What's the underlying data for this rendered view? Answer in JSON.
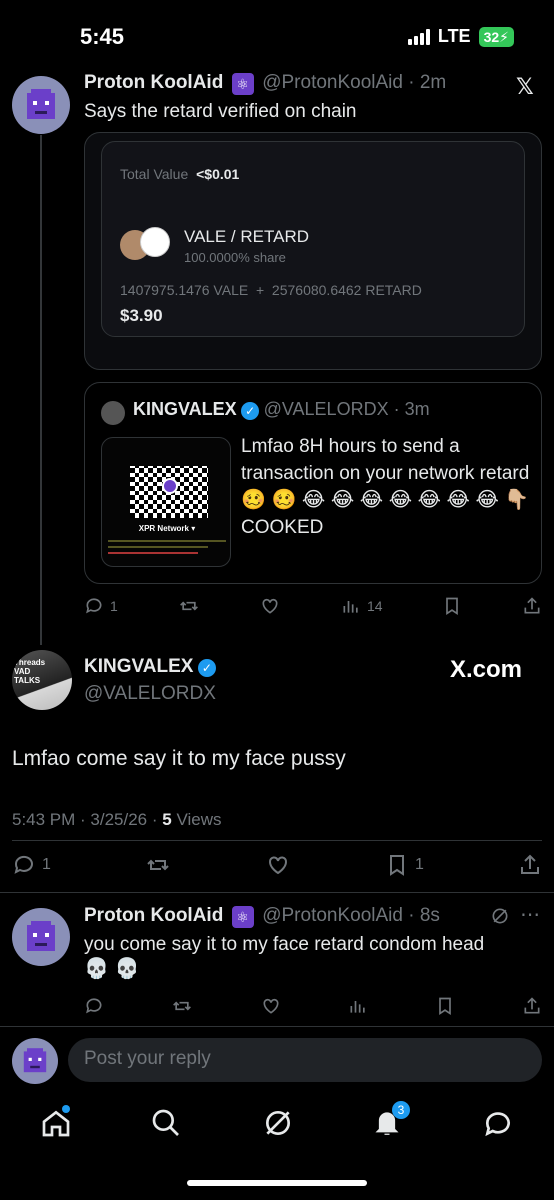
{
  "status": {
    "time": "5:45",
    "network": "LTE",
    "battery": "32"
  },
  "post1": {
    "name": "Proton KoolAid",
    "handle": "@ProtonKoolAid · 2m",
    "text": "Says the retard verified on chain",
    "card": {
      "total_label": "Total Value",
      "total_value": "<$0.01",
      "pair": "VALE / RETARD",
      "share": "100.0000% share",
      "amounts": "1407975.1476 VALE  +  2576080.6462 RETARD",
      "usd": "$3.90"
    },
    "quote": {
      "name": "KINGVALEX",
      "handle": "@VALELORDX · 3m",
      "text": "Lmfao 8H hours to send a transaction on your network retard",
      "emojis": "🥴 🥴 😂 😂 😂 😂 😂 😂 😂 👇🏼",
      "cooked": "COOKED",
      "thumb_caption": "XPR Network ▾"
    },
    "actions": {
      "replies": "1",
      "views": "14"
    }
  },
  "post2": {
    "avatar_caption": "Threads VAD TALKS",
    "name": "KINGVALEX",
    "handle": "@VALELORDX",
    "brand": "X.com",
    "text": "Lmfao come say it to my face pussy",
    "meta_time": "5:43 PM · 3/25/26 · ",
    "meta_views_count": "5",
    "meta_views_label": " Views",
    "actions": {
      "replies": "1",
      "bookmarks": "1"
    }
  },
  "post3": {
    "name": "Proton KoolAid",
    "handle": "@ProtonKoolAid · 8s",
    "text": "you come say it to my face retard condom head",
    "emojis": "💀 💀"
  },
  "reply": {
    "placeholder": "Post your reply"
  },
  "nav": {
    "notifications_badge": "3"
  },
  "colors": {
    "accent": "#1d9bf0",
    "background": "#000000",
    "muted": "#71767b"
  }
}
